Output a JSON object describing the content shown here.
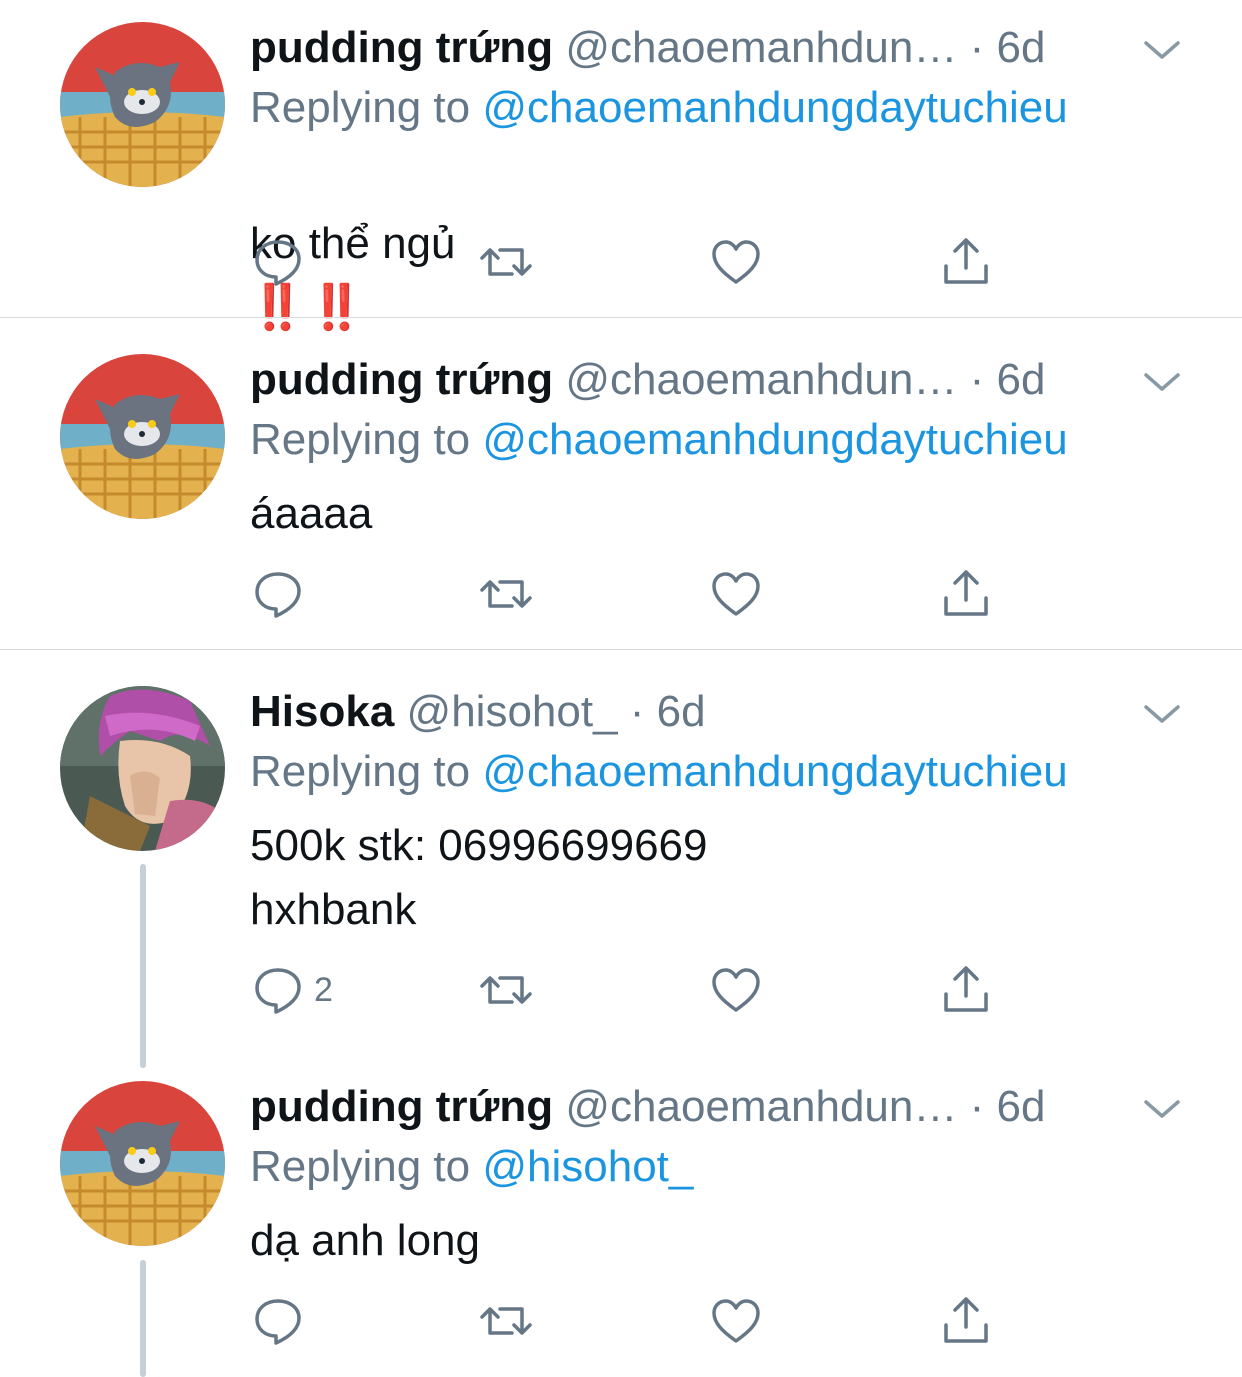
{
  "tweets": [
    {
      "name": "pudding trứng",
      "handle": "@chaoemanhdun…",
      "time": "· 6d",
      "replying_prefix": "Replying to ",
      "replying_to": "@chaoemanhdungdaytuchieu",
      "text": "ko thể ngủ",
      "emoji": "‼️ ‼️",
      "reply_count": ""
    },
    {
      "name": "pudding trứng",
      "handle": "@chaoemanhdun…",
      "time": "· 6d",
      "replying_prefix": "Replying to ",
      "replying_to": "@chaoemanhdungdaytuchieu",
      "text": "áaaaa",
      "reply_count": ""
    },
    {
      "name": "Hisoka",
      "handle": "@hisohot_",
      "time": "· 6d",
      "replying_prefix": "Replying to ",
      "replying_to": "@chaoemanhdungdaytuchieu",
      "text": "500k stk: 06996699669\nhxhbank",
      "reply_count": "2"
    },
    {
      "name": "pudding trứng",
      "handle": "@chaoemanhdun…",
      "time": "· 6d",
      "replying_prefix": "Replying to ",
      "replying_to": "@hisohot_",
      "text": "dạ anh long",
      "reply_count": ""
    }
  ],
  "icons": {
    "reply": "reply-icon",
    "retweet": "retweet-icon",
    "like": "heart-icon",
    "share": "share-icon",
    "caret": "chevron-down-icon"
  },
  "colors": {
    "link": "#1b95e0",
    "secondary": "#657786",
    "emoji_red": "#e0241b",
    "divider": "#d6dbdf",
    "thread_line": "#c4cfd6"
  }
}
